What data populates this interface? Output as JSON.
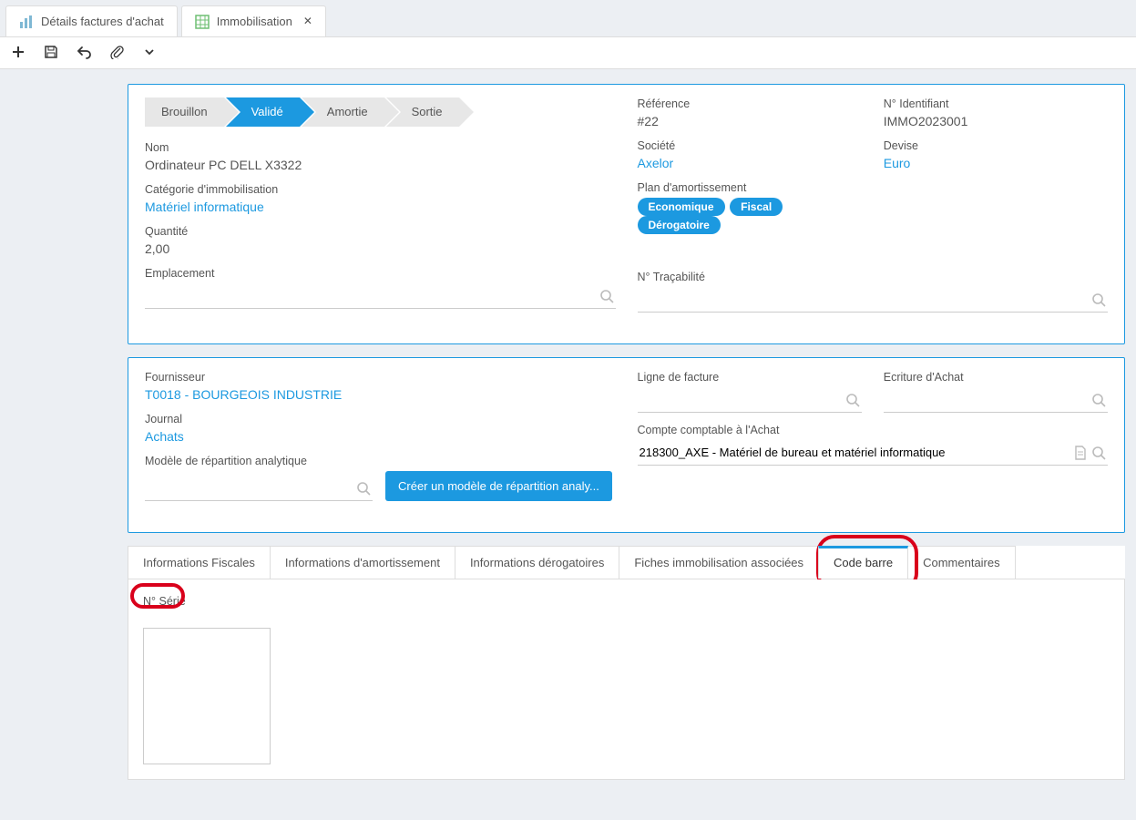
{
  "tabs": {
    "items": [
      {
        "label": "Détails factures d'achat",
        "icon": "chart"
      },
      {
        "label": "Immobilisation",
        "icon": "grid"
      }
    ]
  },
  "status_steps": [
    "Brouillon",
    "Validé",
    "Amortie",
    "Sortie"
  ],
  "status_active_index": 1,
  "panel1": {
    "left": {
      "name_label": "Nom",
      "name_value": "Ordinateur PC DELL X3322",
      "category_label": "Catégorie d'immobilisation",
      "category_value": "Matériel informatique",
      "qty_label": "Quantité",
      "qty_value": "2,00",
      "emplacement_label": "Emplacement"
    },
    "right_top": {
      "ref_label": "Référence",
      "ref_value": "#22",
      "ident_label": "N° Identifiant",
      "ident_value": "IMMO2023001",
      "company_label": "Société",
      "company_value": "Axelor",
      "currency_label": "Devise",
      "currency_value": "Euro",
      "plan_label": "Plan d'amortissement",
      "plan_pills": [
        "Economique",
        "Fiscal",
        "Dérogatoire"
      ]
    },
    "trace_label": "N° Traçabilité"
  },
  "panel2": {
    "supplier_label": "Fournisseur",
    "supplier_value": "T0018 - BOURGEOIS INDUSTRIE",
    "line_label": "Ligne de facture",
    "ecriture_label": "Ecriture d'Achat",
    "journal_label": "Journal",
    "journal_value": "Achats",
    "compte_label": "Compte comptable à l'Achat",
    "compte_value": "218300_AXE - Matériel de bureau et matériel informatique",
    "model_label": "Modèle de répartition analytique",
    "create_btn": "Créer un modèle de répartition analy..."
  },
  "subtabs": [
    "Informations Fiscales",
    "Informations d'amortissement",
    "Informations dérogatoires",
    "Fiches immobilisation associées",
    "Code barre",
    "Commentaires"
  ],
  "subtab_active_index": 4,
  "code_barre": {
    "serie_label": "N° Série"
  }
}
